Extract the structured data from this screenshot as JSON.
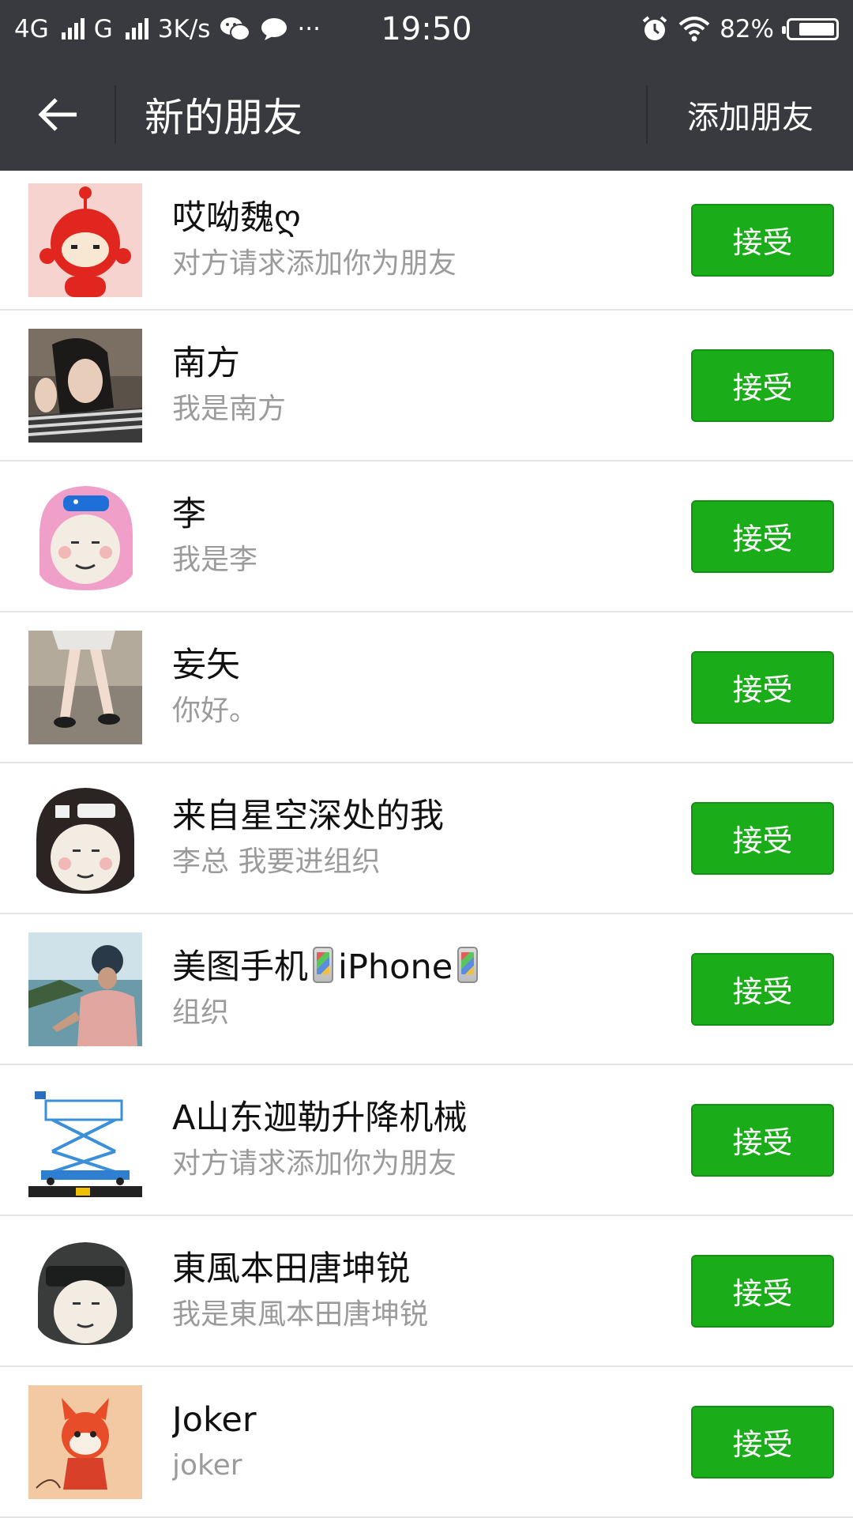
{
  "status_bar": {
    "network_1": "4G",
    "network_2": "G",
    "speed": "3K/s",
    "dots": "···",
    "time": "19:50",
    "battery": "82%",
    "battery_level": 0.82
  },
  "header": {
    "title": "新的朋友",
    "action_label": "添加朋友"
  },
  "colors": {
    "header_bg": "#393a3f",
    "accept_green": "#1aad19",
    "secondary_text": "#9b9b9b"
  },
  "requests": [
    {
      "name": "哎呦魏ღ",
      "message": "对方请求添加你为朋友",
      "button": "接受",
      "avatar": "red-teletubby-avatar"
    },
    {
      "name": "南方",
      "message": "我是南方",
      "button": "接受",
      "avatar": "girl-photo-avatar"
    },
    {
      "name": "李",
      "message": "我是李",
      "button": "接受",
      "avatar": "peppa-helmet-meme-avatar"
    },
    {
      "name": "妄矢",
      "message": "你好。",
      "button": "接受",
      "avatar": "legs-photo-avatar"
    },
    {
      "name": "来自星空深处的我",
      "message": "李总  我要进组织",
      "button": "接受",
      "avatar": "black-cap-meme-avatar"
    },
    {
      "name_parts": [
        "美图手机",
        "iPhone"
      ],
      "message": "组织",
      "button": "接受",
      "avatar": "man-seaside-photo-avatar"
    },
    {
      "name": "A山东迦勒升降机械",
      "message": "对方请求添加你为朋友",
      "button": "接受",
      "avatar": "scissor-lift-avatar"
    },
    {
      "name": "東風本田唐坤锐",
      "message": "我是東風本田唐坤锐",
      "button": "接受",
      "avatar": "helmet-meme-avatar"
    },
    {
      "name": "Joker",
      "message": "joker",
      "button": "接受",
      "avatar": "red-fox-cartoon-avatar"
    }
  ]
}
